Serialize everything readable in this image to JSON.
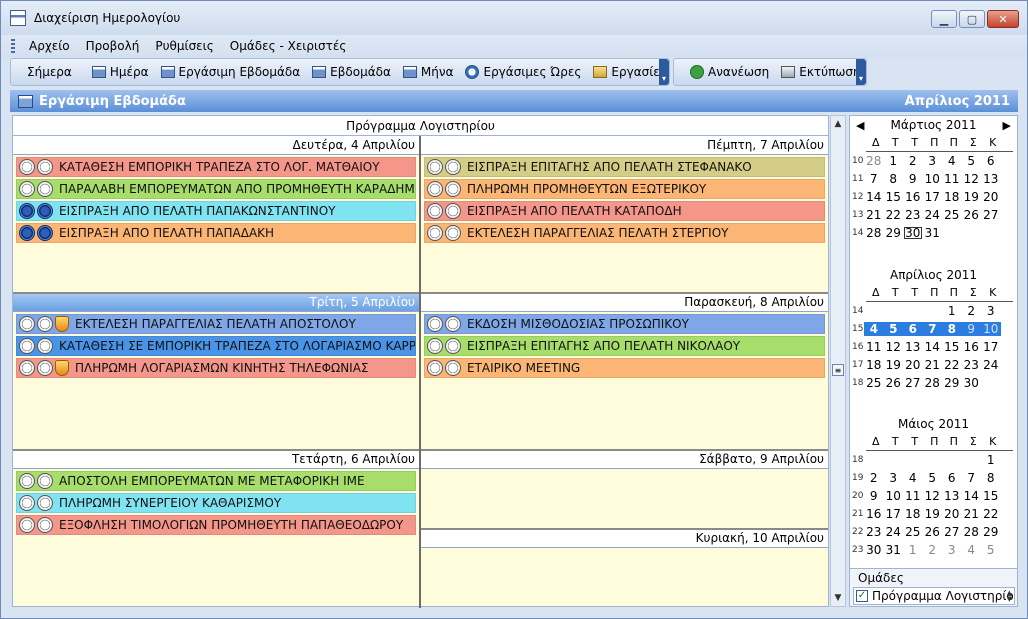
{
  "window": {
    "title": "Διαχείριση Ημερολογίου",
    "btn_min": "▁",
    "btn_max": "▢",
    "btn_close": "✕"
  },
  "menu": [
    "Αρχείο",
    "Προβολή",
    "Ρυθμίσεις",
    "Ομάδες - Χειριστές"
  ],
  "toolbar": {
    "today": "Σήμερα",
    "day": "Ημέρα",
    "workweek": "Εργάσιμη Εβδομάδα",
    "week": "Εβδομάδα",
    "month": "Μήνα",
    "workhours": "Εργάσιμες Ώρες",
    "tasks": "Εργασίες",
    "refresh": "Ανανέωση",
    "print": "Εκτύπωση"
  },
  "header": {
    "view_name": "Εργάσιμη Εβδομάδα",
    "month_label": "Απρίλιος 2011"
  },
  "schedule": {
    "title": "Πρόγραμμα Λογιστηρίου",
    "colors": {
      "red": "#f4978a",
      "green": "#a6dd6b",
      "cyan": "#80e3f2",
      "orange": "#fbb574",
      "olive": "#d4cd87",
      "blue": "#7fa6e6",
      "deepblue": "#4a94e8"
    },
    "days": [
      {
        "label": "Δευτέρα, 4 Απριλίου",
        "today": false,
        "appointments": [
          {
            "text": "ΚΑΤΑΘΕΣΗ ΕΜΠΟΡΙΚΗ ΤΡΑΠΕΖΑ ΣΤΟ ΛΟΓ. ΜΑΤΘΑΙΟΥ",
            "color": "red",
            "icons": [
              "clock",
              "clock"
            ]
          },
          {
            "text": "ΠΑΡΑΛΑΒΗ ΕΜΠΟΡΕΥΜΑΤΩΝ ΑΠΟ ΠΡΟΜΗΘΕΥΤΗ ΚΑΡΑΔΗΜΑ",
            "color": "green",
            "icons": [
              "clock",
              "clock"
            ]
          },
          {
            "text": "ΕΙΣΠΡΑΞΗ ΑΠΟ ΠΕΛΑΤΗ ΠΑΠΑΚΩΝΣΤΑΝΤΙΝΟΥ",
            "color": "cyan",
            "icons": [
              "clock-blue",
              "clock-blue"
            ]
          },
          {
            "text": "ΕΙΣΠΡΑΞΗ ΑΠΟ ΠΕΛΑΤΗ ΠΑΠΑΔΑΚΗ",
            "color": "orange",
            "icons": [
              "clock-blue",
              "clock-blue"
            ]
          }
        ]
      },
      {
        "label": "Τρίτη, 5 Απριλίου",
        "today": true,
        "appointments": [
          {
            "text": "ΕΚΤΕΛΕΣΗ ΠΑΡΑΓΓΕΛΙΑΣ ΠΕΛΑΤΗ ΑΠΟΣΤΟΛΟΥ",
            "color": "blue",
            "icons": [
              "clock",
              "clock",
              "bell"
            ]
          },
          {
            "text": "ΚΑΤΑΘΕΣΗ ΣΕ ΕΜΠΟΡΙΚΗ ΤΡΑΠΕΖΑ ΣΤΟ ΛΟΓΑΡΙΑΣΜΟ ΚΑΡΡΑ",
            "color": "deepblue",
            "icons": [
              "clock",
              "clock"
            ]
          },
          {
            "text": "ΠΛΗΡΩΜΗ ΛΟΓΑΡΙΑΣΜΩΝ ΚΙΝΗΤΗΣ ΤΗΛΕΦΩΝΙΑΣ",
            "color": "red",
            "icons": [
              "clock",
              "clock",
              "bell"
            ]
          }
        ]
      },
      {
        "label": "Τετάρτη, 6 Απριλίου",
        "today": false,
        "appointments": [
          {
            "text": "ΑΠΟΣΤΟΛΗ ΕΜΠΟΡΕΥΜΑΤΩΝ ΜΕ ΜΕΤΑΦΟΡΙΚΗ ΙΜΕ",
            "color": "green",
            "icons": [
              "clock",
              "clock"
            ]
          },
          {
            "text": "ΠΛΗΡΩΜΗ ΣΥΝΕΡΓΕΙΟΥ ΚΑΘΑΡΙΣΜΟΥ",
            "color": "cyan",
            "icons": [
              "clock",
              "clock"
            ]
          },
          {
            "text": "ΕΞΟΦΛΗΣΗ ΤΙΜΟΛΟΓΙΩΝ ΠΡΟΜΗΘΕΥΤΗ ΠΑΠΑΘΕΟΔΩΡΟΥ",
            "color": "red",
            "icons": [
              "clock",
              "clock"
            ]
          }
        ]
      },
      {
        "label": "Πέμπτη, 7 Απριλίου",
        "today": false,
        "appointments": [
          {
            "text": "ΕΙΣΠΡΑΞΗ ΕΠΙΤΑΓΗΣ ΑΠΟ ΠΕΛΑΤΗ ΣΤΕΦΑΝΑΚΟ",
            "color": "olive",
            "icons": [
              "clock",
              "clock"
            ]
          },
          {
            "text": "ΠΛΗΡΩΜΗ ΠΡΟΜΗΘΕΥΤΩΝ ΕΞΩΤΕΡΙΚΟΥ",
            "color": "orange",
            "icons": [
              "clock",
              "clock"
            ]
          },
          {
            "text": "ΕΙΣΠΡΑΞΗ ΑΠΟ ΠΕΛΑΤΗ ΚΑΤΑΠΟΔΗ",
            "color": "red",
            "icons": [
              "clock",
              "clock"
            ]
          },
          {
            "text": "ΕΚΤΕΛΕΣΗ ΠΑΡΑΓΓΕΛΙΑΣ ΠΕΛΑΤΗ ΣΤΕΡΓΙΟΥ",
            "color": "orange",
            "icons": [
              "clock",
              "clock"
            ]
          }
        ]
      },
      {
        "label": "Παρασκευή, 8 Απριλίου",
        "today": false,
        "appointments": [
          {
            "text": "ΕΚΔΟΣΗ ΜΙΣΘΟΔΟΣΙΑΣ ΠΡΟΣΩΠΙΚΟΥ",
            "color": "blue",
            "icons": [
              "clock",
              "clock"
            ]
          },
          {
            "text": "ΕΙΣΠΡΑΞΗ ΕΠΙΤΑΓΗΣ ΑΠΟ ΠΕΛΑΤΗ ΝΙΚΟΛΑΟΥ",
            "color": "green",
            "icons": [
              "clock",
              "clock"
            ]
          },
          {
            "text": "ΕΤΑΙΡΙΚΟ MEETING",
            "color": "orange",
            "icons": [
              "clock",
              "clock"
            ]
          }
        ]
      },
      {
        "label": "Σάββατο, 9 Απριλίου",
        "today": false,
        "appointments": []
      },
      {
        "label": "Κυριακή, 10 Απριλίου",
        "today": false,
        "appointments": []
      }
    ]
  },
  "calendar": {
    "dow": [
      "Δ",
      "Τ",
      "Τ",
      "Π",
      "Π",
      "Σ",
      "Κ"
    ],
    "nav_prev": "◀",
    "nav_next": "▶",
    "months": [
      {
        "name": "Μάρτιος 2011",
        "weeks": [
          {
            "wk": "10",
            "days": [
              [
                "28",
                "gray"
              ],
              [
                "1",
                ""
              ],
              [
                "2",
                ""
              ],
              [
                "3",
                ""
              ],
              [
                "4",
                ""
              ],
              [
                "5",
                ""
              ],
              [
                "6",
                ""
              ]
            ]
          },
          {
            "wk": "11",
            "days": [
              [
                "7",
                ""
              ],
              [
                "8",
                ""
              ],
              [
                "9",
                ""
              ],
              [
                "10",
                ""
              ],
              [
                "11",
                ""
              ],
              [
                "12",
                ""
              ],
              [
                "13",
                ""
              ]
            ]
          },
          {
            "wk": "12",
            "days": [
              [
                "14",
                ""
              ],
              [
                "15",
                ""
              ],
              [
                "16",
                ""
              ],
              [
                "17",
                ""
              ],
              [
                "18",
                ""
              ],
              [
                "19",
                ""
              ],
              [
                "20",
                ""
              ]
            ]
          },
          {
            "wk": "13",
            "days": [
              [
                "21",
                ""
              ],
              [
                "22",
                ""
              ],
              [
                "23",
                ""
              ],
              [
                "24",
                ""
              ],
              [
                "25",
                ""
              ],
              [
                "26",
                ""
              ],
              [
                "27",
                ""
              ]
            ]
          },
          {
            "wk": "14",
            "days": [
              [
                "28",
                ""
              ],
              [
                "29",
                ""
              ],
              [
                "30",
                "today"
              ],
              [
                "31",
                ""
              ],
              [
                "",
                ""
              ],
              [
                "",
                ""
              ],
              [
                "",
                ""
              ]
            ]
          }
        ]
      },
      {
        "name": "Απρίλιος 2011",
        "weeks": [
          {
            "wk": "14",
            "days": [
              [
                "",
                ""
              ],
              [
                "",
                ""
              ],
              [
                "",
                ""
              ],
              [
                "",
                ""
              ],
              [
                "1",
                ""
              ],
              [
                "2",
                ""
              ],
              [
                "3",
                ""
              ]
            ]
          },
          {
            "wk": "15",
            "days": [
              [
                "4",
                "sel"
              ],
              [
                "5",
                "sel"
              ],
              [
                "6",
                "sel"
              ],
              [
                "7",
                "sel"
              ],
              [
                "8",
                "sel"
              ],
              [
                "9",
                "selgray"
              ],
              [
                "10",
                "selgray"
              ]
            ]
          },
          {
            "wk": "16",
            "days": [
              [
                "11",
                ""
              ],
              [
                "12",
                ""
              ],
              [
                "13",
                ""
              ],
              [
                "14",
                ""
              ],
              [
                "15",
                ""
              ],
              [
                "16",
                ""
              ],
              [
                "17",
                ""
              ]
            ]
          },
          {
            "wk": "17",
            "days": [
              [
                "18",
                ""
              ],
              [
                "19",
                ""
              ],
              [
                "20",
                ""
              ],
              [
                "21",
                ""
              ],
              [
                "22",
                ""
              ],
              [
                "23",
                ""
              ],
              [
                "24",
                ""
              ]
            ]
          },
          {
            "wk": "18",
            "days": [
              [
                "25",
                ""
              ],
              [
                "26",
                ""
              ],
              [
                "27",
                ""
              ],
              [
                "28",
                ""
              ],
              [
                "29",
                ""
              ],
              [
                "30",
                ""
              ],
              [
                "",
                ""
              ]
            ]
          }
        ]
      },
      {
        "name": "Μάιος 2011",
        "weeks": [
          {
            "wk": "18",
            "days": [
              [
                "",
                ""
              ],
              [
                "",
                ""
              ],
              [
                "",
                ""
              ],
              [
                "",
                ""
              ],
              [
                "",
                ""
              ],
              [
                "",
                ""
              ],
              [
                "1",
                ""
              ]
            ]
          },
          {
            "wk": "19",
            "days": [
              [
                "2",
                ""
              ],
              [
                "3",
                ""
              ],
              [
                "4",
                ""
              ],
              [
                "5",
                ""
              ],
              [
                "6",
                ""
              ],
              [
                "7",
                ""
              ],
              [
                "8",
                ""
              ]
            ]
          },
          {
            "wk": "20",
            "days": [
              [
                "9",
                ""
              ],
              [
                "10",
                ""
              ],
              [
                "11",
                ""
              ],
              [
                "12",
                ""
              ],
              [
                "13",
                ""
              ],
              [
                "14",
                ""
              ],
              [
                "15",
                ""
              ]
            ]
          },
          {
            "wk": "21",
            "days": [
              [
                "16",
                ""
              ],
              [
                "17",
                ""
              ],
              [
                "18",
                ""
              ],
              [
                "19",
                ""
              ],
              [
                "20",
                ""
              ],
              [
                "21",
                ""
              ],
              [
                "22",
                ""
              ]
            ]
          },
          {
            "wk": "22",
            "days": [
              [
                "23",
                ""
              ],
              [
                "24",
                ""
              ],
              [
                "25",
                ""
              ],
              [
                "26",
                ""
              ],
              [
                "27",
                ""
              ],
              [
                "28",
                ""
              ],
              [
                "29",
                ""
              ]
            ]
          },
          {
            "wk": "23",
            "days": [
              [
                "30",
                ""
              ],
              [
                "31",
                ""
              ],
              [
                "1",
                "gray"
              ],
              [
                "2",
                "gray"
              ],
              [
                "3",
                "gray"
              ],
              [
                "4",
                "gray"
              ],
              [
                "5",
                "gray"
              ]
            ]
          }
        ]
      }
    ]
  },
  "groups": {
    "label": "Ομάδες",
    "item": "Πρόγραμμα Λογιστηρίου",
    "checked": "✓"
  }
}
